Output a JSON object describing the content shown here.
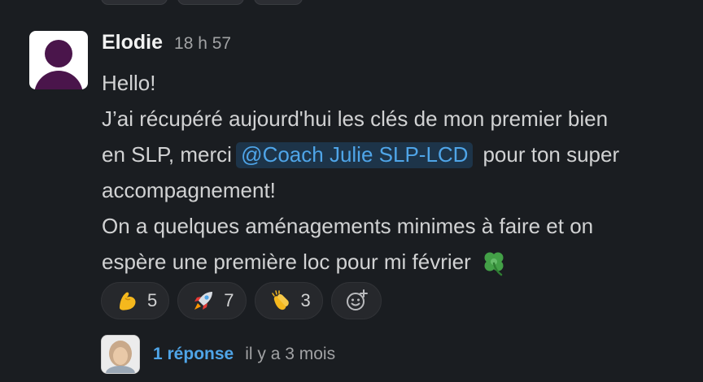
{
  "message": {
    "author": "Elodie",
    "timestamp": "18 h 57",
    "lines": {
      "l1": "Hello!",
      "l2": "J’ai récupéré aujourd'hui les clés de mon premier bien",
      "l3_pre": "en SLP, merci",
      "mention": "@Coach Julie SLP-LCD",
      "l3_post": "pour ton super",
      "l4": "accompagnement!",
      "l5": "On a quelques aménagements minimes à faire et on",
      "l6": "espère une première loc pour mi février"
    }
  },
  "reactions": [
    {
      "emoji": "flexed-biceps",
      "count": "5"
    },
    {
      "emoji": "rocket",
      "count": "7"
    },
    {
      "emoji": "clapping-hands",
      "count": "3"
    }
  ],
  "thread": {
    "replies_label": "1 réponse",
    "last_reply": "il y a 3 mois"
  },
  "colors": {
    "background": "#1a1d21",
    "text": "#d1d2d3",
    "mention_bg": "#1d3449",
    "link": "#4fa5e8",
    "avatar_purple": "#4a154b"
  }
}
